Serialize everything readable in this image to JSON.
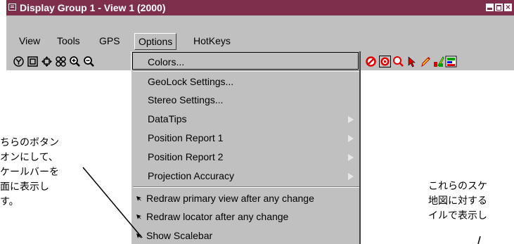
{
  "window": {
    "title": "Display Group 1 - View 1 (2000)"
  },
  "menubar": {
    "items": [
      "View",
      "Tools",
      "GPS",
      "Options",
      "HotKeys"
    ],
    "open_menu": "Options"
  },
  "toolbar": {
    "left_icons": [
      "geolock-icon",
      "fullview-icon",
      "pan-icon",
      "zoom-extents-icon",
      "zoom-in-icon",
      "zoom-out-icon"
    ],
    "right_icons": [
      "no-entry-icon",
      "target-icon",
      "magnifier-icon",
      "select-pointer-icon",
      "pencil-icon",
      "draw-tools-icon",
      "layer-controls-icon"
    ]
  },
  "options_menu": {
    "items": [
      {
        "label": "Colors...",
        "submenu": false,
        "highlighted": true
      },
      {
        "label": "GeoLock Settings...",
        "submenu": false
      },
      {
        "label": "Stereo Settings...",
        "submenu": false
      },
      {
        "label": "DataTips",
        "submenu": true
      },
      {
        "label": "Position Report 1",
        "submenu": true
      },
      {
        "label": "Position Report 2",
        "submenu": true
      },
      {
        "label": "Projection Accuracy",
        "submenu": true
      }
    ],
    "checks": [
      {
        "label": "Redraw primary view after any change",
        "checked": true
      },
      {
        "label": "Redraw locator after any change",
        "checked": true
      },
      {
        "label": "Show Scalebar",
        "checked": true
      }
    ]
  },
  "callout_left": [
    "ちらのボタン",
    "オンにして、",
    "ケールバーを",
    "面に表示し",
    "す。"
  ],
  "callout_right": [
    "これらのスケ",
    "地図に対する",
    "イルで表示し"
  ],
  "colors": {
    "titlebar": "#7e2f4c",
    "chrome": "#c0c0c0"
  }
}
